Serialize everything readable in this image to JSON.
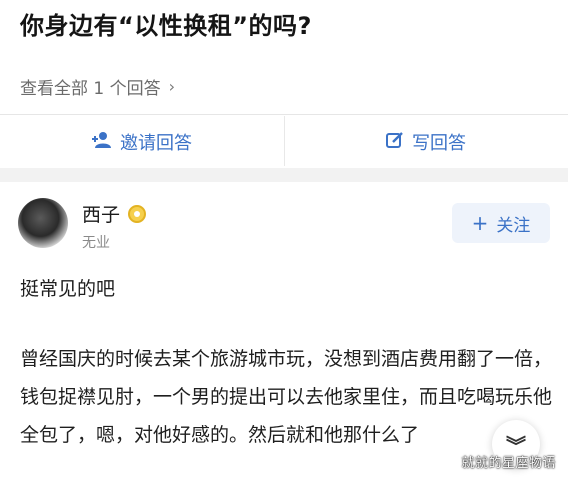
{
  "question": {
    "title": "你身边有“以性换租”的吗?"
  },
  "answers_link": {
    "label": "查看全部 1 个回答",
    "chevron": "›"
  },
  "actions": {
    "invite": {
      "label": "邀请回答",
      "icon": "add-user-icon"
    },
    "write": {
      "label": "写回答",
      "icon": "edit-icon"
    }
  },
  "answer": {
    "author": {
      "name": "西子",
      "occupation": "无业",
      "badge_icon": "badge-icon"
    },
    "follow": {
      "label": "关注",
      "icon": "+"
    },
    "paragraphs": [
      "挺常见的吧",
      "曾经国庆的时候去某个旅游城市玩，没想到酒店费用翻了一倍，钱包捉襟见肘，一个男的提出可以去他家里住，而且吃喝玩乐他全包了，嗯，对他好感的。然后就和他那什么了"
    ]
  },
  "float_button": {
    "icon": "double-chevron-down-icon",
    "glyph": "︾"
  },
  "watermark": "就就的星座物语",
  "colors": {
    "accent": "#3b72c7",
    "band": "#f2f2f2",
    "muted": "#8a8a8a"
  }
}
